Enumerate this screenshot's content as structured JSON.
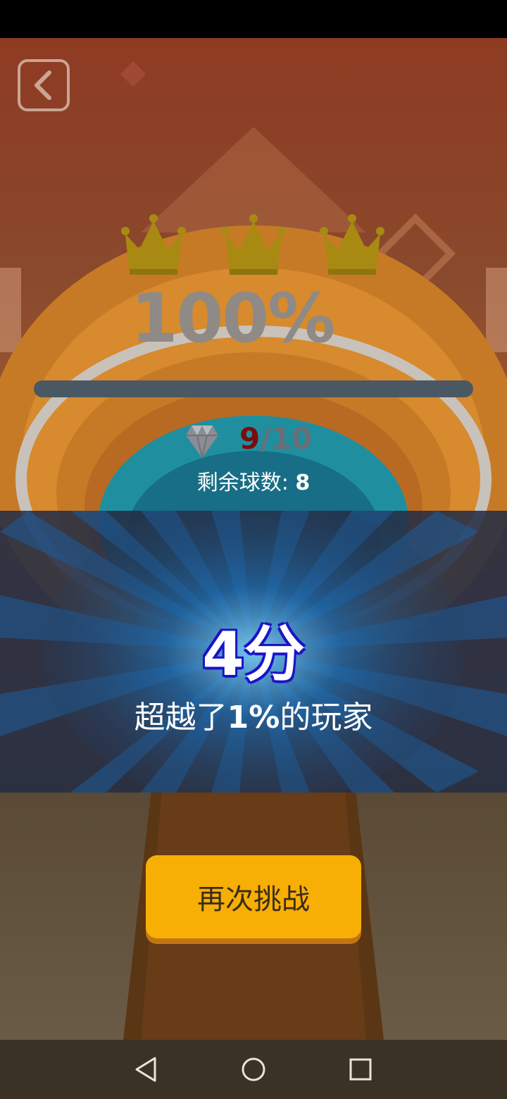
{
  "hud": {
    "back_icon": "chevron-left-icon",
    "crowns_earned": 3,
    "crowns_total": 3,
    "progress_label": "100%",
    "progress_fraction": 1.0
  },
  "gems": {
    "current": "9",
    "separator_total": "/10",
    "icon": "diamond-icon"
  },
  "balls": {
    "label": "剩余球数:",
    "value": "8"
  },
  "result": {
    "score": "4分",
    "beat_prefix": "超越了",
    "beat_percent": "1%",
    "beat_suffix": "的玩家"
  },
  "actions": {
    "retry_label": "再次挑战"
  },
  "navigation": {
    "back_icon": "triangle-back-icon",
    "home_icon": "circle-home-icon",
    "recents_icon": "square-recents-icon"
  },
  "colors": {
    "retry_button": "#f7ae05",
    "crown": "#a88a12",
    "score_outline": "#1a14c8",
    "gem_current": "#7a0c0c"
  }
}
